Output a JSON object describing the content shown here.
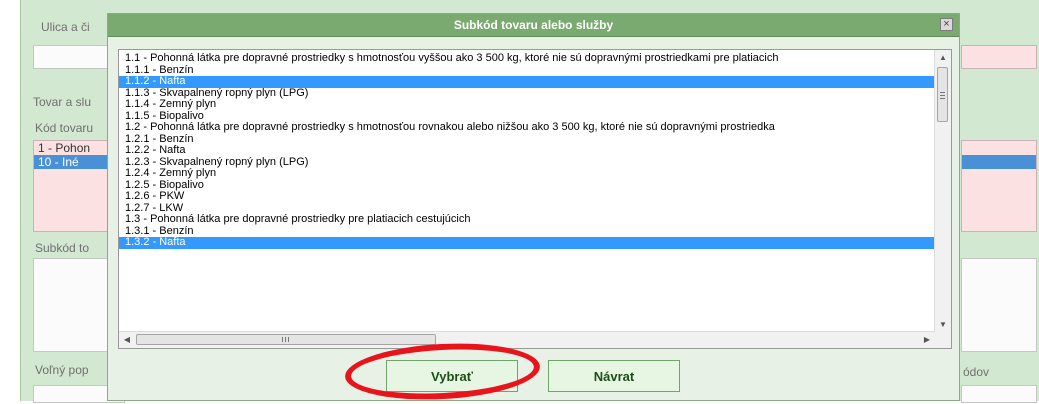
{
  "background": {
    "street_label": "Ulica a či",
    "goods_label": "Tovar a slu",
    "goods_code_label": "Kód tovaru",
    "goods_codes": [
      "1 - Pohon",
      "10 - Iné"
    ],
    "subcode_label": "Subkód to",
    "free_desc_label": "Voľný pop",
    "right_label": "ódov"
  },
  "dialog": {
    "title": "Subkód tovaru alebo služby",
    "close_symbol": "×",
    "items": [
      {
        "label": "1.1 - Pohonná látka pre dopravné prostriedky s hmotnosťou vyššou ako 3 500 kg, ktoré nie sú dopravnými prostriedkami pre platiacich",
        "selected": false
      },
      {
        "label": "1.1.1 - Benzín",
        "selected": false
      },
      {
        "label": "1.1.2 - Nafta",
        "selected": true
      },
      {
        "label": "1.1.3 - Skvapalnený ropný plyn (LPG)",
        "selected": false
      },
      {
        "label": "1.1.4 - Zemný plyn",
        "selected": false
      },
      {
        "label": "1.1.5 - Biopalivo",
        "selected": false
      },
      {
        "label": "1.2 - Pohonná látka pre dopravné prostriedky s hmotnosťou rovnakou alebo nižšou ako 3 500 kg, ktoré nie sú dopravnými prostriedka",
        "selected": false
      },
      {
        "label": "1.2.1 - Benzín",
        "selected": false
      },
      {
        "label": "1.2.2 - Nafta",
        "selected": false
      },
      {
        "label": "1.2.3 - Skvapalnený ropný plyn (LPG)",
        "selected": false
      },
      {
        "label": "1.2.4 - Zemný plyn",
        "selected": false
      },
      {
        "label": "1.2.5 - Biopalivo",
        "selected": false
      },
      {
        "label": "1.2.6 - PKW",
        "selected": false
      },
      {
        "label": "1.2.7 - LKW",
        "selected": false
      },
      {
        "label": "1.3 - Pohonná látka pre dopravné prostriedky pre platiacich cestujúcich",
        "selected": false
      },
      {
        "label": "1.3.1 - Benzín",
        "selected": false
      },
      {
        "label": "1.3.2 - Nafta",
        "selected": true
      }
    ],
    "select_button": "Vybrať",
    "back_button": "Návrat",
    "highlight_color": "#e8141b"
  }
}
